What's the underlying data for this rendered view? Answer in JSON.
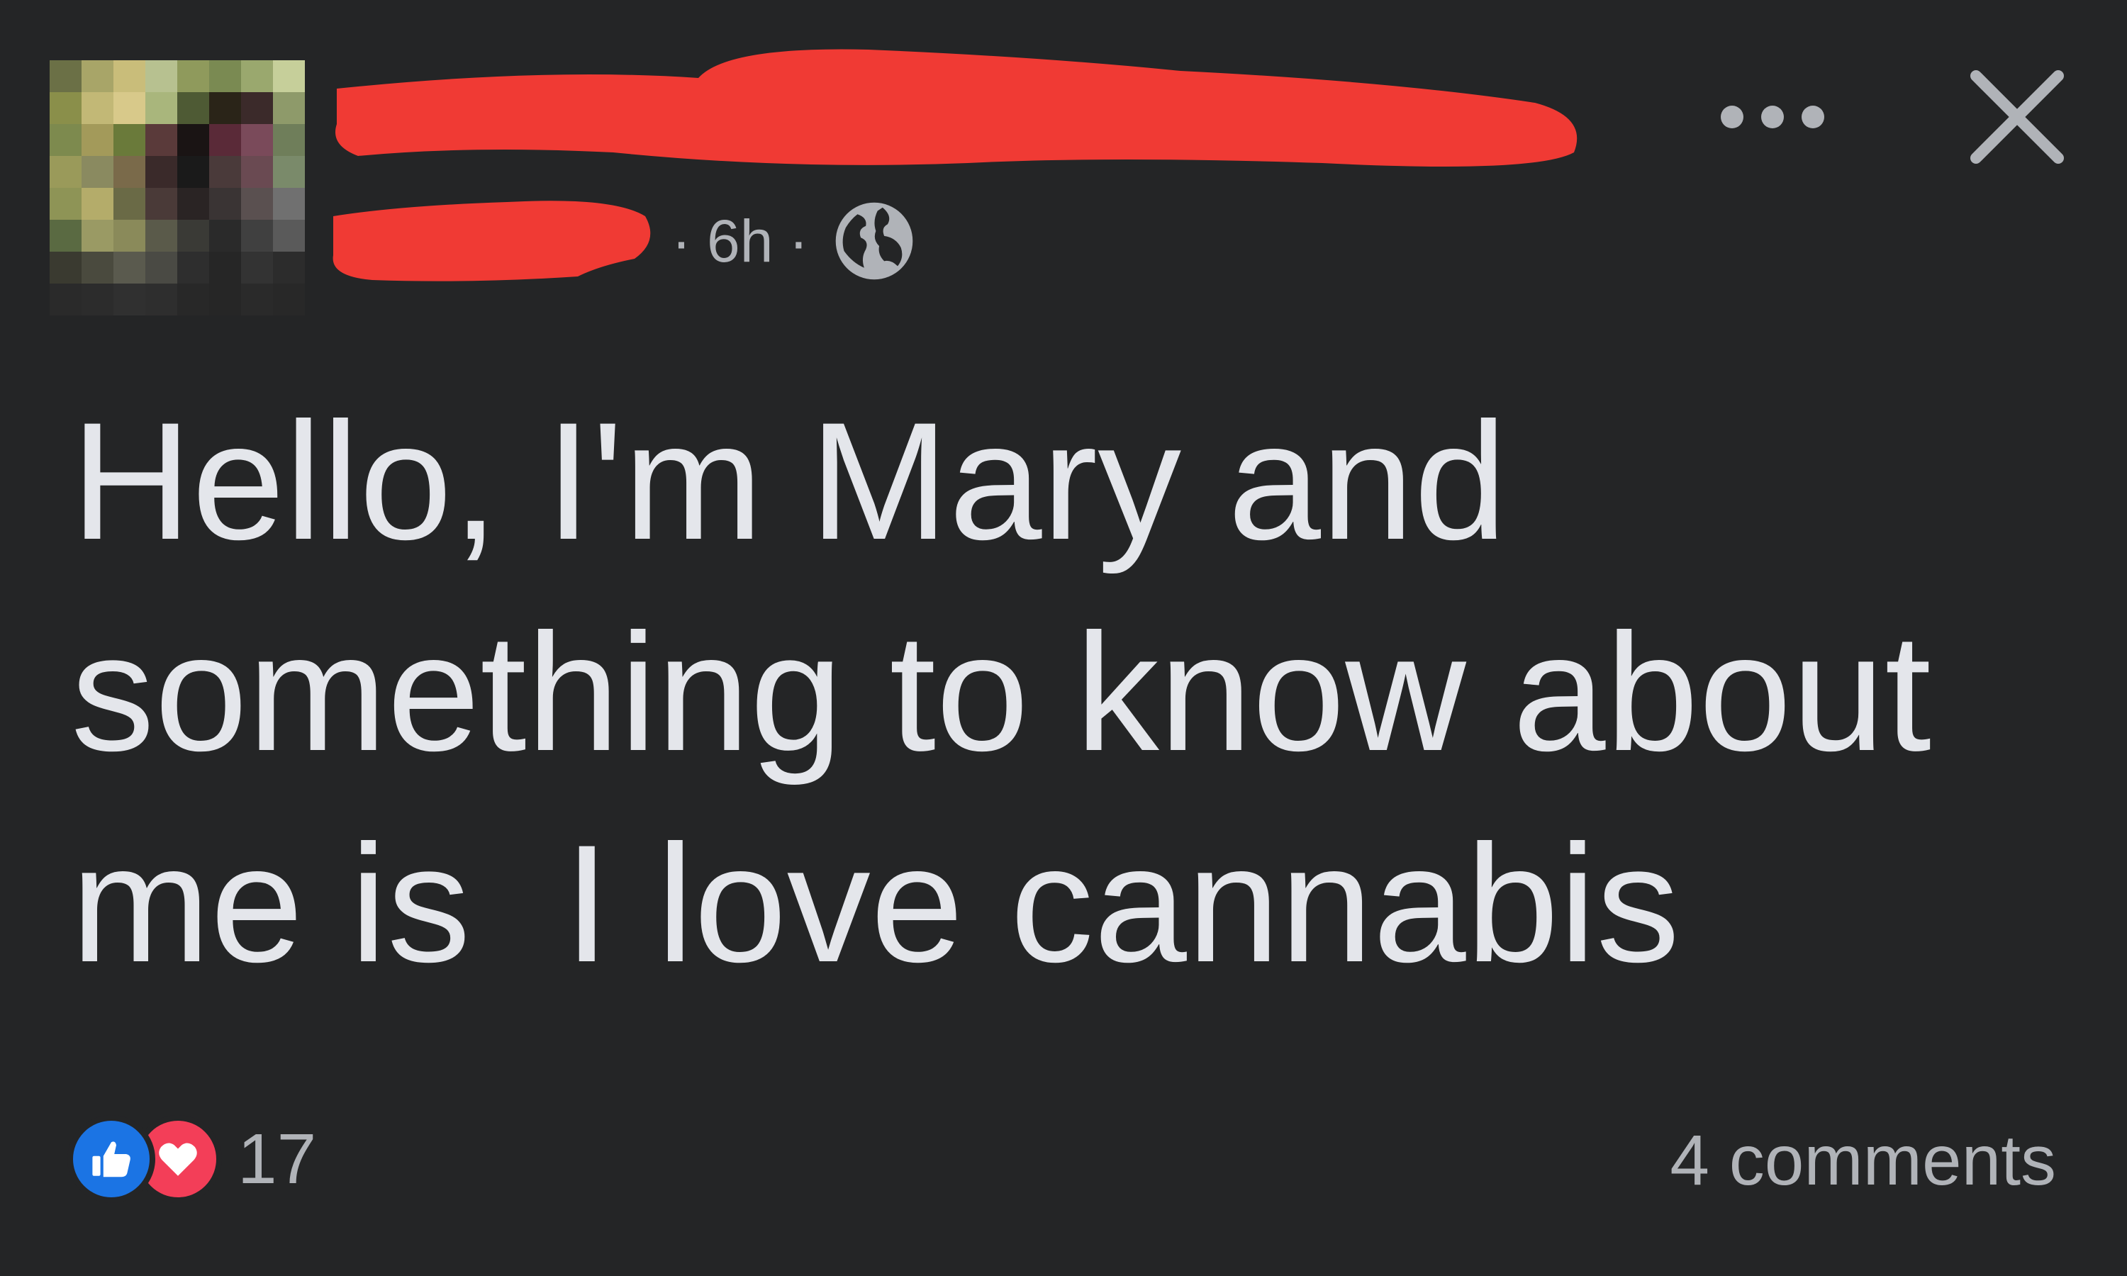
{
  "post": {
    "time": "6h",
    "separator": "·",
    "privacy_icon": "globe-icon",
    "text": "Hello, I'm Mary and\nsomething to know about\nme is  I love cannabis"
  },
  "header_actions": {
    "more_icon": "ellipsis-icon",
    "close_icon": "close-icon"
  },
  "footer": {
    "reaction_icons": [
      "like-icon",
      "love-icon"
    ],
    "reaction_count": "17",
    "comments": "4 comments"
  },
  "colors": {
    "background": "#242526",
    "primary_text": "#e4e6eb",
    "secondary_text": "#b0b3b8",
    "redaction": "#f03a34",
    "like_blue": "#1b74e4",
    "love_red": "#f33e58"
  }
}
